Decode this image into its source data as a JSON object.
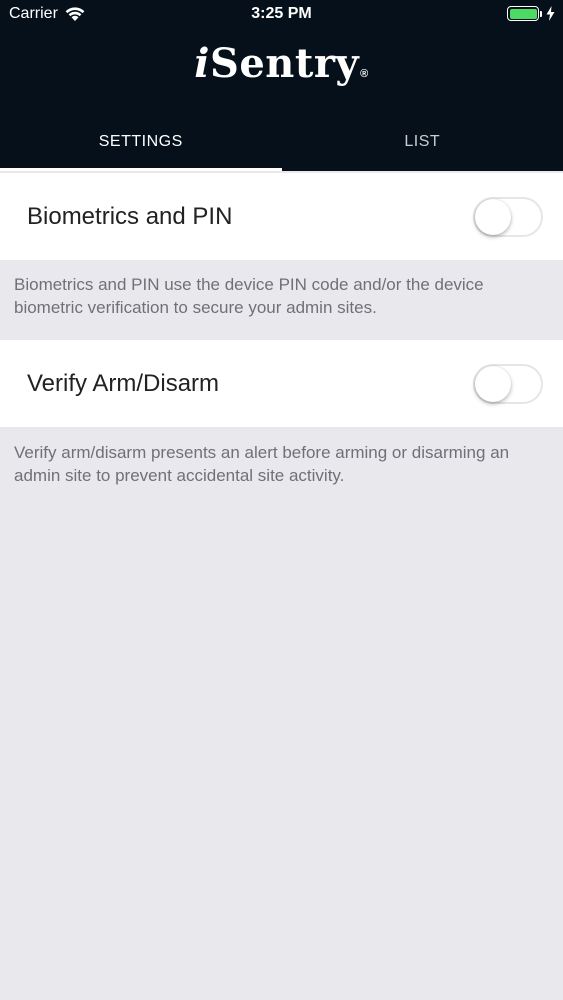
{
  "status_bar": {
    "carrier": "Carrier",
    "time": "3:25 PM",
    "battery_color": "#4cd964",
    "wifi_icon": "wifi-icon",
    "battery_icon": "battery-icon",
    "charging_icon": "lightning-bolt-icon"
  },
  "header": {
    "logo_prefix": "i",
    "logo_main": "Sentry",
    "logo_reg": "®",
    "background": "#06101a"
  },
  "tabs": [
    {
      "label": "SETTINGS",
      "active": true
    },
    {
      "label": "LIST",
      "active": false
    }
  ],
  "settings": [
    {
      "label": "Biometrics and PIN",
      "enabled": false,
      "description": "Biometrics and PIN use the device PIN code and/or the device biometric verification to secure your admin sites."
    },
    {
      "label": "Verify Arm/Disarm",
      "enabled": false,
      "description": "Verify arm/disarm presents an alert before arming or disarming an admin site to prevent accidental site activity."
    }
  ]
}
